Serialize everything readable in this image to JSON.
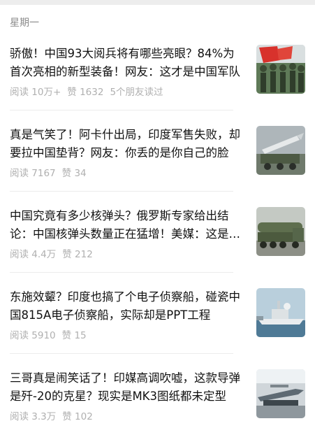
{
  "section": {
    "day": "星期一"
  },
  "articles": [
    {
      "title": "骄傲！中国93大阅兵将有哪些亮眼？84%为首次亮相的新型装备！网友：这才是中国军队",
      "reads": "阅读 10万+",
      "likes": "赞 1632",
      "friends": "5个朋友读过",
      "thumb_icon": "parade-photo"
    },
    {
      "title": "真是气笑了！阿卡什出局，印度军售失败，却要拉中国垫背？网友：你丢的是你自己的脸",
      "reads": "阅读 7167",
      "likes": "赞 34",
      "thumb_icon": "missile-launcher-photo"
    },
    {
      "title": "中国究竟有多少核弹头？俄罗斯专家给出结论：中国核弹头数量正在猛增！美媒：这是事实",
      "reads": "阅读 4.4万",
      "likes": "赞 212",
      "thumb_icon": "missile-truck-photo"
    },
    {
      "title": "东施效颦？印度也搞了个电子侦察船，碰瓷中国815A电子侦察船，实际却是PPT工程",
      "reads": "阅读 5910",
      "likes": "赞 15",
      "thumb_icon": "ship-photo"
    },
    {
      "title": "三哥真是闹笑话了！印媒高调吹嘘，这款导弹是歼-20的克星？现实是MK3图纸都未定型",
      "reads": "阅读 3.3万",
      "likes": "赞 102",
      "thumb_icon": "missile-display-photo"
    }
  ]
}
